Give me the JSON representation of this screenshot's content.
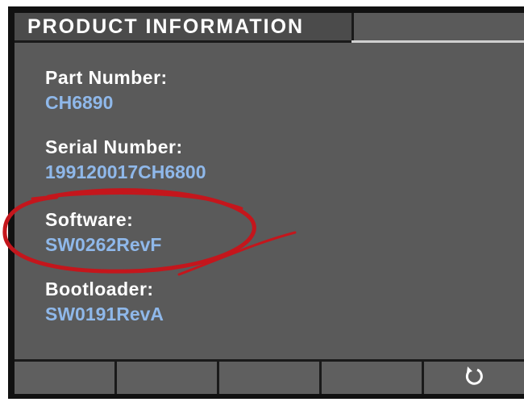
{
  "header": {
    "title": "PRODUCT INFORMATION"
  },
  "fields": [
    {
      "label": "Part Number:",
      "value": "CH6890"
    },
    {
      "label": "Serial Number:",
      "value": "199120017CH6800"
    },
    {
      "label": "Software:",
      "value": "SW0262RevF"
    },
    {
      "label": "Bootloader:",
      "value": "SW0191RevA"
    }
  ],
  "softkeys": {
    "back_icon": "back-arrow-icon"
  },
  "annotation": {
    "color": "#c4161c",
    "shape": "hand-drawn ellipse around Software field"
  }
}
